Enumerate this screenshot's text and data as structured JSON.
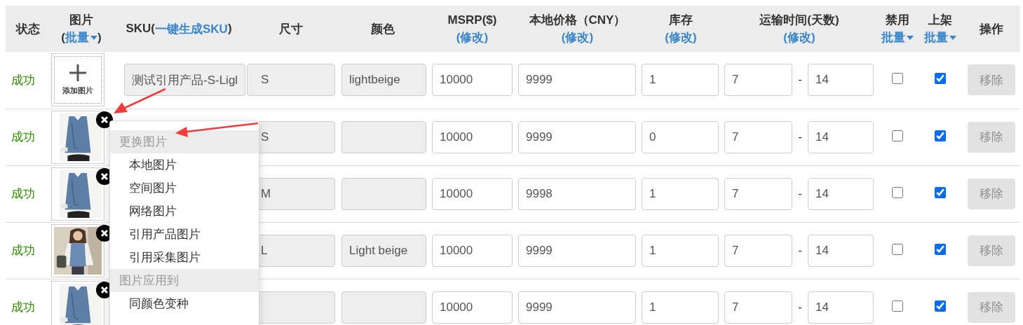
{
  "columns": [
    {
      "title": "状态",
      "kind": "plain"
    },
    {
      "title": "图片",
      "prefix": "(",
      "link": "批量",
      "caret": true,
      "suffix": ")",
      "kind": "stacked"
    },
    {
      "title": "SKU(",
      "link": "一键生成SKU",
      "suffix": ")",
      "kind": "inline"
    },
    {
      "title": "尺寸",
      "kind": "plain"
    },
    {
      "title": "颜色",
      "kind": "plain"
    },
    {
      "title": "MSRP($)",
      "link": "(修改)",
      "kind": "stacked"
    },
    {
      "title": "本地价格（CNY）",
      "link": "(修改)",
      "kind": "stacked"
    },
    {
      "title": "库存",
      "link": "(修改)",
      "kind": "stacked"
    },
    {
      "title": "运输时间(天数)",
      "link": "(修改)",
      "kind": "stacked"
    },
    {
      "title": "禁用",
      "link": "批量",
      "caret": true,
      "kind": "stacked"
    },
    {
      "title": "上架",
      "link": "批量",
      "caret": true,
      "kind": "stacked"
    },
    {
      "title": "操作",
      "kind": "plain"
    }
  ],
  "rows": [
    {
      "status": "成功",
      "image": {
        "kind": "add",
        "label": "添加图片"
      },
      "sku": "测试引用产品-S-Ligl",
      "size": "S",
      "color_text": "lightbeige",
      "msrp": "10000",
      "price": "9999",
      "stock": "1",
      "ship_min": "7",
      "ship_sep": "-",
      "ship_max": "14",
      "disabled": false,
      "listed": true,
      "remove": {
        "label": "移除",
        "disabled": true
      }
    },
    {
      "status": "成功",
      "image": {
        "kind": "vest",
        "removable": true
      },
      "size": "S",
      "msrp": "10000",
      "price": "9999",
      "stock": "0",
      "ship_min": "7",
      "ship_sep": "-",
      "ship_max": "14",
      "disabled": false,
      "listed": true,
      "remove": {
        "label": "移除",
        "disabled": true
      }
    },
    {
      "status": "成功",
      "image": {
        "kind": "vest",
        "removable": true
      },
      "size": "M",
      "msrp": "10000",
      "price": "9998",
      "stock": "1",
      "ship_min": "7",
      "ship_sep": "-",
      "ship_max": "14",
      "disabled": false,
      "listed": true,
      "remove": {
        "label": "移除",
        "disabled": true
      }
    },
    {
      "status": "成功",
      "image": {
        "kind": "person",
        "removable": true
      },
      "size": "L",
      "color_text": "Light beige",
      "msrp": "10000",
      "price": "9999",
      "stock": "1",
      "ship_min": "7",
      "ship_sep": "-",
      "ship_max": "14",
      "disabled": false,
      "listed": true,
      "remove": {
        "label": "移除",
        "disabled": true
      }
    },
    {
      "status": "成功",
      "image": {
        "kind": "vest",
        "removable": true
      },
      "msrp": "10000",
      "price": "9999",
      "stock": "1",
      "ship_min": "7",
      "ship_sep": "-",
      "ship_max": "14",
      "disabled": false,
      "listed": true,
      "remove": {
        "label": "移除",
        "disabled": true
      }
    }
  ],
  "menu": {
    "sections": [
      {
        "title": "更换图片",
        "items": [
          "本地图片",
          "空间图片",
          "网络图片",
          "引用产品图片",
          "引用采集图片"
        ]
      },
      {
        "title": "图片应用到",
        "items": [
          "同颜色变种"
        ]
      }
    ]
  }
}
